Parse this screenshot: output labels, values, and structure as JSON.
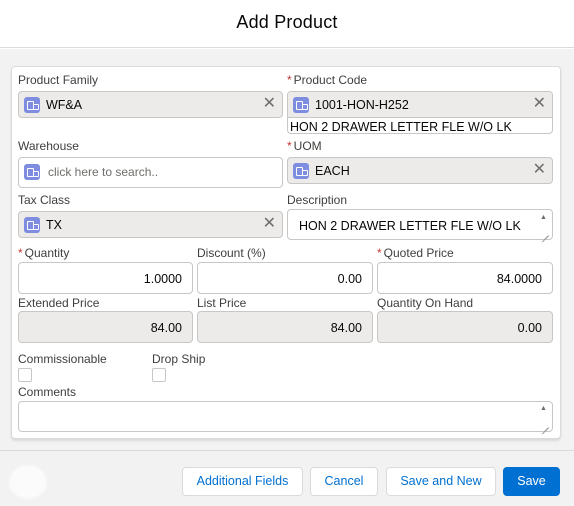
{
  "modal": {
    "title": "Add Product"
  },
  "form": {
    "product_family": {
      "label": "Product Family",
      "value": "WF&A",
      "clear": "✕"
    },
    "product_code": {
      "label": "Product Code",
      "required": "*",
      "value": "1001-HON-H252",
      "subtext": "HON 2 DRAWER LETTER FLE W/O LK",
      "clear": "✕"
    },
    "warehouse": {
      "label": "Warehouse",
      "placeholder": "click here to search.."
    },
    "uom": {
      "label": "UOM",
      "required": "*",
      "value": "EACH",
      "clear": "✕"
    },
    "tax_class": {
      "label": "Tax Class",
      "value": "TX",
      "clear": "✕"
    },
    "description": {
      "label": "Description",
      "value": "HON 2 DRAWER LETTER FLE W/O LK"
    },
    "quantity": {
      "label": "Quantity",
      "required": "*",
      "value": "1.0000"
    },
    "discount": {
      "label": "Discount (%)",
      "value": "0.00"
    },
    "quoted_price": {
      "label": "Quoted Price",
      "required": "*",
      "value": "84.0000"
    },
    "extended_price": {
      "label": "Extended Price",
      "value": "84.00"
    },
    "list_price": {
      "label": "List Price",
      "value": "84.00"
    },
    "quantity_on_hand": {
      "label": "Quantity On Hand",
      "value": "0.00"
    },
    "commissionable": {
      "label": "Commissionable",
      "checked": false
    },
    "drop_ship": {
      "label": "Drop Ship",
      "checked": false
    },
    "comments": {
      "label": "Comments",
      "value": ""
    }
  },
  "footer": {
    "additional_fields": "Additional Fields",
    "cancel": "Cancel",
    "save_and_new": "Save and New",
    "save": "Save"
  },
  "icons": {
    "lookup": "record-lookup-icon",
    "clear": "close-icon",
    "spin_up": "▲",
    "spin_down": "▼"
  },
  "colors": {
    "brand": "#0070d2",
    "required": "#c23934",
    "pill_icon": "#7f8de1"
  }
}
